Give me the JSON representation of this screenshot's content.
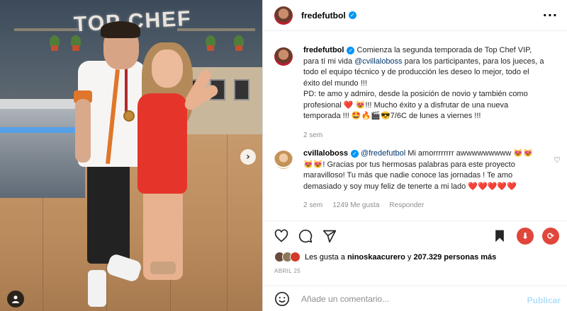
{
  "photo": {
    "sign_text": "TOP CHEF",
    "next_icon": "chevron-right-icon",
    "tag_icon": "user-tag-icon"
  },
  "post": {
    "author": "fredefutbol",
    "verified": true,
    "more_icon": "more-horizontal-icon"
  },
  "caption": {
    "username": "fredefutbol",
    "text_1": " Comienza la segunda temporada de Top Chef VIP, para tí mi vida ",
    "mention": "@cvillaloboss",
    "text_2": " para los participantes, para los jueces, a todo el equipo técnico y de producción les deseo lo mejor, todo el éxito del mundo !!!",
    "text_3": "PD: te amo y admiro, desde la posición de novio y también como profesional ❤️ 😻!!! Mucho éxito y a disfrutar de una nueva temporada !!! 🤩🔥🎬😎7/6C de lunes a viernes !!!",
    "time": "2 sem"
  },
  "reply": {
    "username": "cvillaloboss",
    "mention": "@fredefutbol",
    "text": " Mi amorrrrrrrr awwwwwwwww 😻😻😻😻! Gracias por tus hermosas palabras para este proyecto maravilloso! Tu más que nadie conoce las jornadas ! Te amo demasiado y soy muy feliz de tenerte a mi lado ❤️❤️❤️❤️❤️",
    "time": "2 sem",
    "likes": "1249 Me gusta",
    "reply_label": "Responder"
  },
  "actions": {
    "like_icon": "heart-icon",
    "comment_icon": "comment-icon",
    "share_icon": "send-icon",
    "save_icon": "bookmark-icon",
    "download_icon": "download-icon",
    "repost_icon": "repost-icon"
  },
  "likes": {
    "prefix": "Les gusta a ",
    "user": "ninoskaacurero",
    "middle": " y ",
    "count": "207.329 personas más"
  },
  "date": "ABRIL 25",
  "comment_box": {
    "placeholder": "Añade un comentario...",
    "publish": "Publicar",
    "emoji_icon": "smiley-icon"
  },
  "colors": {
    "verified": "#0095f6",
    "publish": "#b2dffc",
    "mention": "#00376b",
    "download_badge": "#e0463a"
  }
}
